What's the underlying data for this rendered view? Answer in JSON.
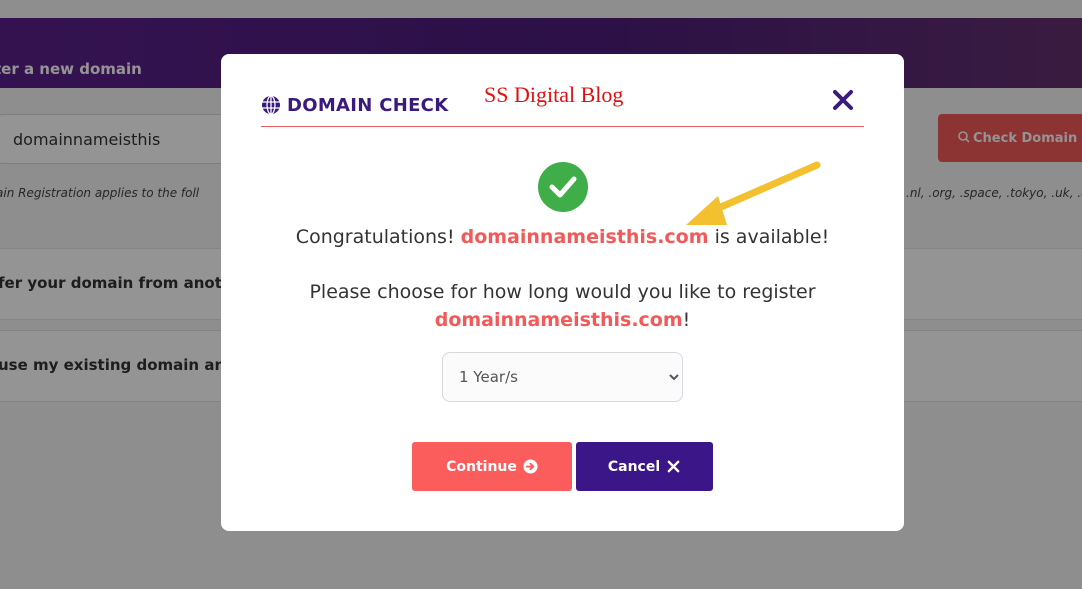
{
  "background": {
    "header_title": "ter a new domain",
    "search_value": "domainnameisthis",
    "check_button_label": "Check Domain",
    "note_left": "ain Registration applies to the foll",
    "note_right": ".nl, .org, .space, .tokyo, .uk, .u",
    "option_transfer": "fer your domain from anoth",
    "option_existing": "use my existing domain and"
  },
  "modal": {
    "title": "DOMAIN CHECK",
    "watermark": "SS Digital Blog",
    "congrats_prefix": "Congratulations! ",
    "domain": "domainnameisthis.com",
    "congrats_suffix": " is available!",
    "choose_text": "Please choose for how long would you like to register",
    "choose_suffix": "!",
    "term_selected": "1 Year/s",
    "continue_label": "Continue",
    "cancel_label": "Cancel"
  },
  "icons": {
    "globe": "globe-icon",
    "close": "close-icon",
    "success": "check-circle-icon",
    "continue": "arrow-circle-right-icon",
    "cancel": "times-icon",
    "search": "search-icon",
    "annotation_arrow": "arrow-annotation"
  },
  "colors": {
    "accent_red": "#f25a5a",
    "brand_purple": "#3b1688",
    "success_green": "#3fae49",
    "annotation_yellow": "#f3c030"
  }
}
